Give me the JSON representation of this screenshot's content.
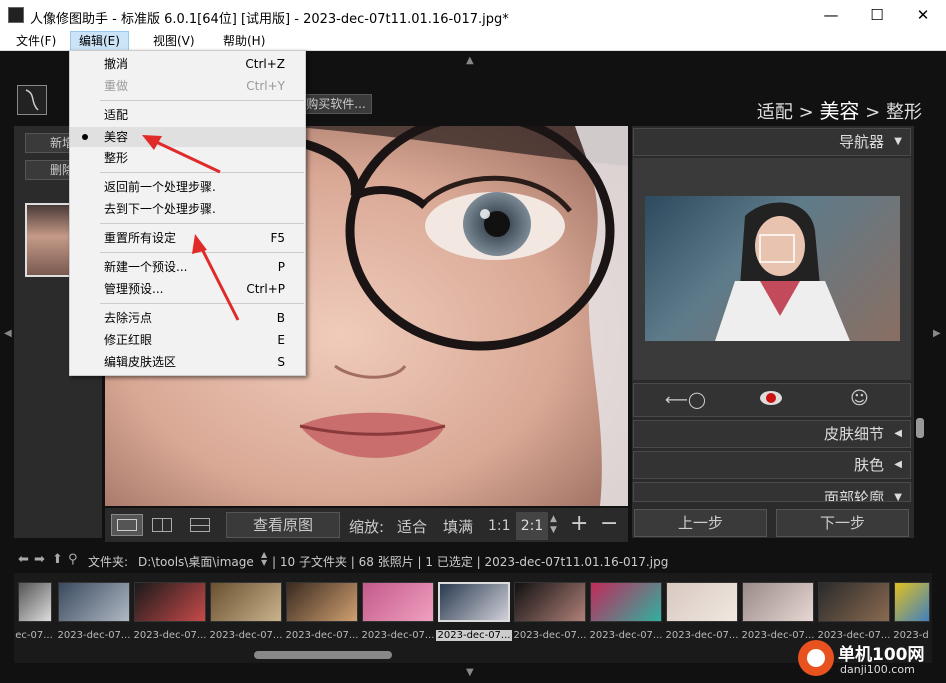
{
  "window": {
    "title": "人像修图助手 - 标准版 6.0.1[64位] [试用版] - 2023-dec-07t11.01.16-017.jpg*",
    "minimize": "—",
    "maximize": "☐",
    "close": "✕"
  },
  "menubar": {
    "items": [
      "文件(F)",
      "编辑(E)",
      "视图(V)",
      "帮助(H)"
    ],
    "active_index": 1
  },
  "edit_menu": {
    "items": [
      {
        "label": "撤消",
        "shortcut": "Ctrl+Z",
        "disabled": false
      },
      {
        "label": "重做",
        "shortcut": "Ctrl+Y",
        "disabled": true
      },
      {
        "label": "适配",
        "shortcut": "",
        "disabled": false
      },
      {
        "label": "美容",
        "shortcut": "",
        "disabled": false,
        "checked": true
      },
      {
        "label": "整形",
        "shortcut": "",
        "disabled": false
      },
      {
        "label": "返回前一个处理步骤.",
        "shortcut": "",
        "disabled": false
      },
      {
        "label": "去到下一个处理步骤.",
        "shortcut": "",
        "disabled": false
      },
      {
        "label": "重置所有设定",
        "shortcut": "F5",
        "disabled": false
      },
      {
        "label": "新建一个预设...",
        "shortcut": "P",
        "disabled": false
      },
      {
        "label": "管理预设...",
        "shortcut": "Ctrl+P",
        "disabled": false
      },
      {
        "label": "去除污点",
        "shortcut": "B",
        "disabled": false
      },
      {
        "label": "修正红眼",
        "shortcut": "E",
        "disabled": false
      },
      {
        "label": "编辑皮肤选区",
        "shortcut": "S",
        "disabled": false
      }
    ]
  },
  "toolbar": {
    "buy_button": "购买软件...",
    "new_button": "新增",
    "delete_button": "删除"
  },
  "steps": {
    "step1": "适配",
    "sep": ">",
    "step2": "美容",
    "step3": "整形"
  },
  "right_panel": {
    "navigator": "导航器",
    "skin_detail": "皮肤细节",
    "skin_color": "肤色",
    "face_contour": "面部轮廓",
    "prev_step": "上一步",
    "next_step": "下一步"
  },
  "bottom_toolbar": {
    "view_original": "查看原图",
    "zoom_label": "缩放:",
    "fit": "适合",
    "fill": "填满",
    "ratio_1": "1:1",
    "ratio_2": "2:1",
    "plus": "+",
    "minus": "−"
  },
  "path_bar": {
    "folder_label": "文件夹:",
    "path": "D:\\tools\\桌面\\image",
    "info": "| 10 子文件夹 | 68 张照片 | 1 已选定 | 2023-dec-07t11.01.16-017.jpg"
  },
  "filmstrip": {
    "labels": [
      "2023-dec-07...",
      "2023-dec-07...",
      "2023-dec-07...",
      "2023-dec-07...",
      "2023-dec-07...",
      "2023-dec-07...",
      "2023-dec-07...",
      "2023-dec-07...",
      "2023-dec-07...",
      "2023-dec-07...",
      "2023-dec-07...",
      "2023-dec-07..."
    ],
    "first_partial": "ec-07...",
    "last_partial": "2023-d",
    "selected_index": 5
  },
  "watermark": {
    "brand": "单机100网",
    "url": "danji100.com"
  },
  "colors": {
    "accent_red": "#e12a2a",
    "menu_highlight": "#cce4f7"
  }
}
